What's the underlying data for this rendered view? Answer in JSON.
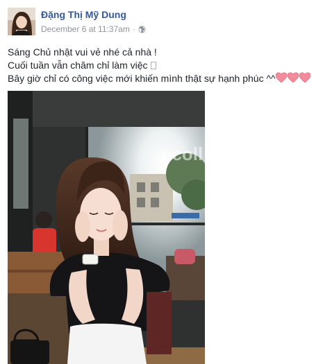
{
  "post": {
    "author_name": "Đặng Thị Mỹ Dung",
    "timestamp": "December 6 at 11:37am",
    "separator": "·",
    "audience_icon": "globe-icon",
    "lines": [
      "Sáng Chủ nhật vui vẻ nhé cả nhà !",
      "Cuối tuần vẫn chăm chỉ làm việc",
      "Bây giờ chỉ có công việc mới khiến mình thật sự hạnh phúc ^^"
    ],
    "emoji": [
      "heart-emoji",
      "heart-emoji",
      "heart-emoji"
    ],
    "photo_sign_text": "ecoll"
  },
  "colors": {
    "author": "#365899",
    "meta": "#90949c",
    "text": "#1d2129",
    "heart": "#f28b9a"
  }
}
